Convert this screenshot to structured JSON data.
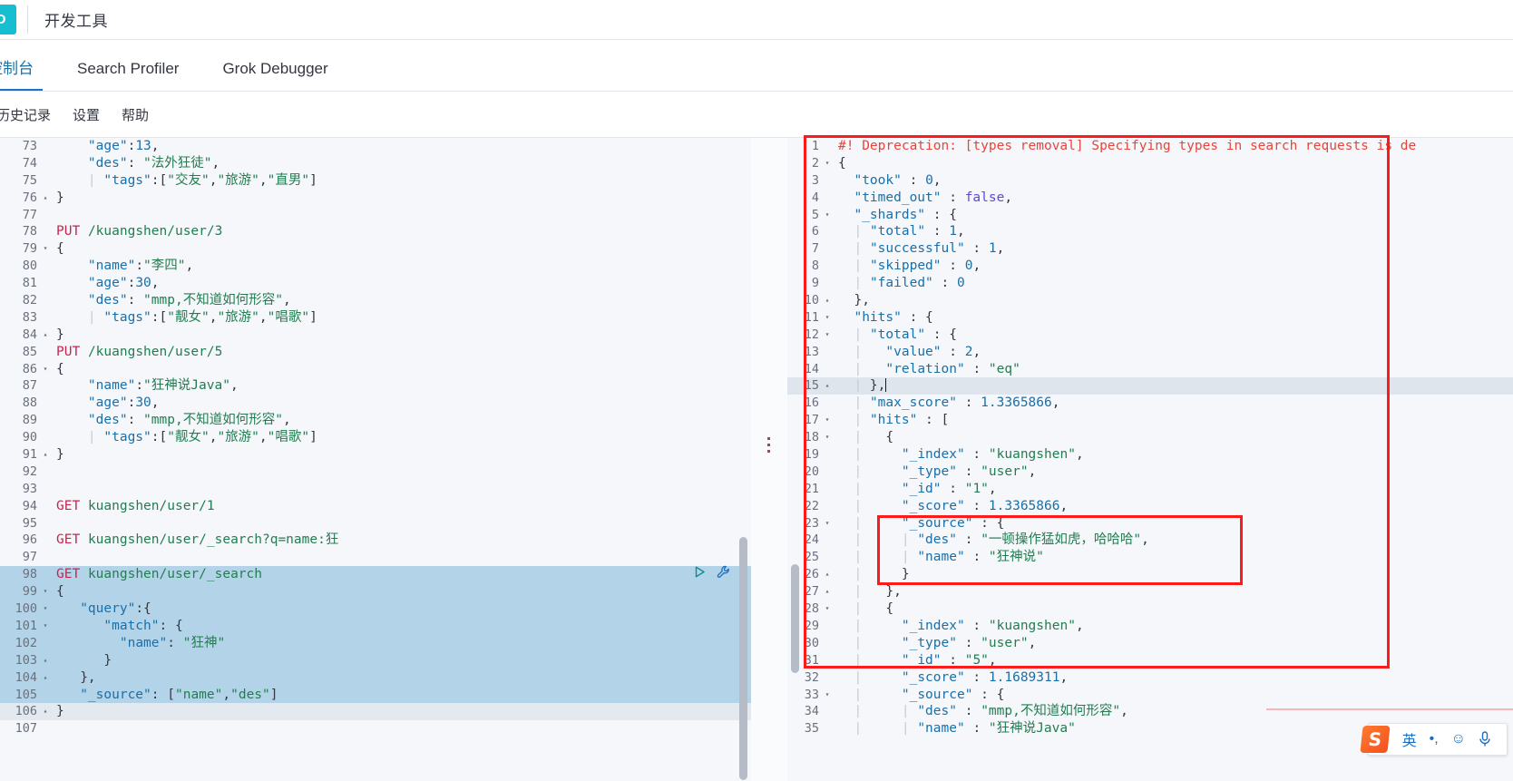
{
  "brand": {
    "logo_text": "D"
  },
  "header": {
    "app_title": "开发工具"
  },
  "tabs": [
    {
      "label": "控制台",
      "active": true
    },
    {
      "label": "Search Profiler",
      "active": false
    },
    {
      "label": "Grok Debugger",
      "active": false
    }
  ],
  "menu": [
    {
      "label": "历史记录"
    },
    {
      "label": "设置"
    },
    {
      "label": "帮助"
    }
  ],
  "request_actions": {
    "play_title": "play-button",
    "wrench_title": "wrench-button"
  },
  "ime": {
    "logo": "S",
    "mode": "英",
    "punct": "•,",
    "emoji": "☺",
    "mic": "🎤"
  },
  "editor_left": {
    "first_line_number": 73,
    "lines": [
      {
        "n": 73,
        "fold": "",
        "text": "    \"age\":13,"
      },
      {
        "n": 74,
        "fold": "",
        "text": "    \"des\": \"法外狂徒\","
      },
      {
        "n": 75,
        "fold": "",
        "text": "    | \"tags\":[\"交友\",\"旅游\",\"直男\"]"
      },
      {
        "n": 76,
        "fold": "▴",
        "text": "}"
      },
      {
        "n": 77,
        "fold": "",
        "text": ""
      },
      {
        "n": 78,
        "fold": "",
        "text": "PUT /kuangshen/user/3"
      },
      {
        "n": 79,
        "fold": "▾",
        "text": "{"
      },
      {
        "n": 80,
        "fold": "",
        "text": "    \"name\":\"李四\","
      },
      {
        "n": 81,
        "fold": "",
        "text": "    \"age\":30,"
      },
      {
        "n": 82,
        "fold": "",
        "text": "    \"des\": \"mmp,不知道如何形容\","
      },
      {
        "n": 83,
        "fold": "",
        "text": "    | \"tags\":[\"靓女\",\"旅游\",\"唱歌\"]"
      },
      {
        "n": 84,
        "fold": "▴",
        "text": "}"
      },
      {
        "n": 85,
        "fold": "",
        "text": "PUT /kuangshen/user/5"
      },
      {
        "n": 86,
        "fold": "▾",
        "text": "{"
      },
      {
        "n": 87,
        "fold": "",
        "text": "    \"name\":\"狂神说Java\","
      },
      {
        "n": 88,
        "fold": "",
        "text": "    \"age\":30,"
      },
      {
        "n": 89,
        "fold": "",
        "text": "    \"des\": \"mmp,不知道如何形容\","
      },
      {
        "n": 90,
        "fold": "",
        "text": "    | \"tags\":[\"靓女\",\"旅游\",\"唱歌\"]"
      },
      {
        "n": 91,
        "fold": "▴",
        "text": "}"
      },
      {
        "n": 92,
        "fold": "",
        "text": ""
      },
      {
        "n": 93,
        "fold": "",
        "text": ""
      },
      {
        "n": 94,
        "fold": "",
        "text": "GET kuangshen/user/1"
      },
      {
        "n": 95,
        "fold": "",
        "text": ""
      },
      {
        "n": 96,
        "fold": "",
        "text": "GET kuangshen/user/_search?q=name:狂"
      },
      {
        "n": 97,
        "fold": "",
        "text": ""
      },
      {
        "n": 98,
        "fold": "",
        "text": "GET kuangshen/user/_search"
      },
      {
        "n": 99,
        "fold": "▾",
        "text": "{"
      },
      {
        "n": 100,
        "fold": "▾",
        "text": "   \"query\":{"
      },
      {
        "n": 101,
        "fold": "▾",
        "text": "    | \"match\": {"
      },
      {
        "n": 102,
        "fold": "",
        "text": "    |   \"name\": \"狂神\""
      },
      {
        "n": 103,
        "fold": "▴",
        "text": "    | }"
      },
      {
        "n": 104,
        "fold": "▴",
        "text": "   },"
      },
      {
        "n": 105,
        "fold": "",
        "text": "   \"_source\": [\"name\",\"des\"]"
      },
      {
        "n": 106,
        "fold": "▴",
        "text": "}"
      },
      {
        "n": 107,
        "fold": "",
        "text": ""
      }
    ],
    "selected_from": 98,
    "selected_to": 105,
    "current_line": 106
  },
  "editor_right": {
    "lines": [
      {
        "n": 1,
        "fold": "",
        "text": "#! Deprecation: [types removal] Specifying types in search requests is de"
      },
      {
        "n": 2,
        "fold": "▾",
        "text": "{"
      },
      {
        "n": 3,
        "fold": "",
        "text": "  \"took\" : 0,"
      },
      {
        "n": 4,
        "fold": "",
        "text": "  \"timed_out\" : false,"
      },
      {
        "n": 5,
        "fold": "▾",
        "text": "  \"_shards\" : {"
      },
      {
        "n": 6,
        "fold": "",
        "text": "  | \"total\" : 1,"
      },
      {
        "n": 7,
        "fold": "",
        "text": "  | \"successful\" : 1,"
      },
      {
        "n": 8,
        "fold": "",
        "text": "  | \"skipped\" : 0,"
      },
      {
        "n": 9,
        "fold": "",
        "text": "  | \"failed\" : 0"
      },
      {
        "n": 10,
        "fold": "▴",
        "text": "  },"
      },
      {
        "n": 11,
        "fold": "▾",
        "text": "  \"hits\" : {"
      },
      {
        "n": 12,
        "fold": "▾",
        "text": "  | \"total\" : {"
      },
      {
        "n": 13,
        "fold": "",
        "text": "  |   \"value\" : 2,"
      },
      {
        "n": 14,
        "fold": "",
        "text": "  |   \"relation\" : \"eq\""
      },
      {
        "n": 15,
        "fold": "▴",
        "text": "  | },"
      },
      {
        "n": 16,
        "fold": "",
        "text": "  | \"max_score\" : 1.3365866,"
      },
      {
        "n": 17,
        "fold": "▾",
        "text": "  | \"hits\" : ["
      },
      {
        "n": 18,
        "fold": "▾",
        "text": "  |   {"
      },
      {
        "n": 19,
        "fold": "",
        "text": "  |     \"_index\" : \"kuangshen\","
      },
      {
        "n": 20,
        "fold": "",
        "text": "  |     \"_type\" : \"user\","
      },
      {
        "n": 21,
        "fold": "",
        "text": "  |     \"_id\" : \"1\","
      },
      {
        "n": 22,
        "fold": "",
        "text": "  |     \"_score\" : 1.3365866,"
      },
      {
        "n": 23,
        "fold": "▾",
        "text": "  |     \"_source\" : {"
      },
      {
        "n": 24,
        "fold": "",
        "text": "  |     | \"des\" : \"一顿操作猛如虎，哈哈哈\","
      },
      {
        "n": 25,
        "fold": "",
        "text": "  |     | \"name\" : \"狂神说\""
      },
      {
        "n": 26,
        "fold": "▴",
        "text": "  |     }"
      },
      {
        "n": 27,
        "fold": "▴",
        "text": "  |   },"
      },
      {
        "n": 28,
        "fold": "▾",
        "text": "  |   {"
      },
      {
        "n": 29,
        "fold": "",
        "text": "  |     \"_index\" : \"kuangshen\","
      },
      {
        "n": 30,
        "fold": "",
        "text": "  |     \"_type\" : \"user\","
      },
      {
        "n": 31,
        "fold": "",
        "text": "  |     \"_id\" : \"5\","
      },
      {
        "n": 32,
        "fold": "",
        "text": "  |     \"_score\" : 1.1689311,"
      },
      {
        "n": 33,
        "fold": "▾",
        "text": "  |     \"_source\" : {"
      },
      {
        "n": 34,
        "fold": "",
        "text": "  |     | \"des\" : \"mmp,不知道如何形容\","
      },
      {
        "n": 35,
        "fold": "",
        "text": "  |     | \"name\" : \"狂神说Java\""
      }
    ],
    "highlight_line": 15
  },
  "response_values": {
    "took": 0,
    "timed_out": "false",
    "shards_total": 1,
    "shards_successful": 1,
    "shards_skipped": 0,
    "shards_failed": 0,
    "hits_total_value": 2,
    "hits_total_relation": "eq",
    "max_score": 1.3365866,
    "hit1_index": "kuangshen",
    "hit1_type": "user",
    "hit1_id": "1",
    "hit1_score": 1.3365866,
    "hit1_des": "一顿操作猛如虎，哈哈哈",
    "hit1_name": "狂神说",
    "hit2_index": "kuangshen",
    "hit2_type": "user",
    "hit2_id": "5",
    "hit2_score": 1.1689311,
    "hit2_des": "mmp,不知道如何形容",
    "hit2_name": "狂神说Java"
  },
  "colors": {
    "accent": "#1a73c9",
    "brand": "#17becf",
    "annotation": "#fc1a1a",
    "selection": "#b3d4e8",
    "string": "#227d51",
    "key": "#1a6fa8",
    "method": "#c7254e",
    "warning": "#e7453c"
  }
}
